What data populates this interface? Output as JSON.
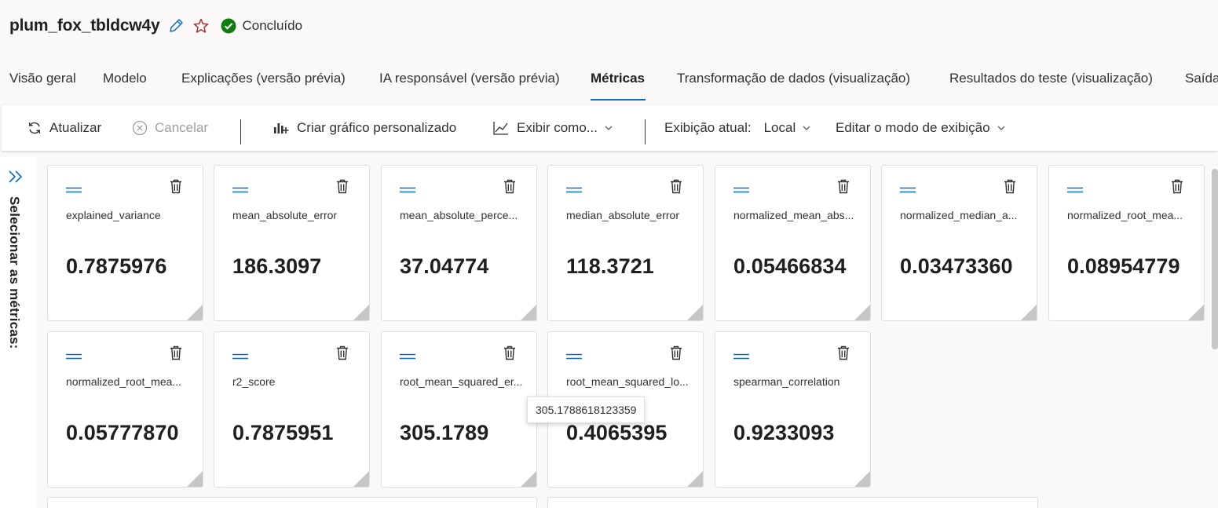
{
  "header": {
    "run_name": "plum_fox_tbldcw4y",
    "status": "Concluído",
    "colors": {
      "accent": "#0f6cbd",
      "success": "#107c10",
      "favorite": "#a4262c"
    }
  },
  "tabs": [
    {
      "label": "Visão geral",
      "active": false
    },
    {
      "label": "Modelo",
      "active": false
    },
    {
      "label": "Explicações (versão prévia)",
      "active": false
    },
    {
      "label": "IA responsável (versão prévia)",
      "active": false
    },
    {
      "label": "Métricas",
      "active": true
    },
    {
      "label": "Transformação de dados (visualização)",
      "active": false
    },
    {
      "label": "Resultados do teste (visualização)",
      "active": false
    },
    {
      "label": "Saída",
      "active": false
    }
  ],
  "toolbar": {
    "refresh": "Atualizar",
    "cancel": "Cancelar",
    "custom_chart": "Criar gráfico personalizado",
    "view_as": "Exibir como...",
    "current_view_label": "Exibição atual:",
    "current_view_value": "Local",
    "edit_view": "Editar o modo de exibição"
  },
  "sidebar": {
    "label": "Selecionar as métricas:"
  },
  "metrics": [
    {
      "name": "explained_variance",
      "value": "0.7875976"
    },
    {
      "name": "mean_absolute_error",
      "value": "186.3097"
    },
    {
      "name": "mean_absolute_perce...",
      "value": "37.04774"
    },
    {
      "name": "median_absolute_error",
      "value": "118.3721"
    },
    {
      "name": "normalized_mean_abs...",
      "value": "0.05466834"
    },
    {
      "name": "normalized_median_a...",
      "value": "0.03473360"
    },
    {
      "name": "normalized_root_mea...",
      "value": "0.08954779"
    },
    {
      "name": "normalized_root_mea...",
      "value": "0.05777870"
    },
    {
      "name": "r2_score",
      "value": "0.7875951"
    },
    {
      "name": "root_mean_squared_er...",
      "value": "305.1789"
    },
    {
      "name": "root_mean_squared_lo...",
      "value": "0.4065395"
    },
    {
      "name": "spearman_correlation",
      "value": "0.9233093"
    }
  ],
  "tooltip": {
    "text": "305.1788618123359"
  }
}
